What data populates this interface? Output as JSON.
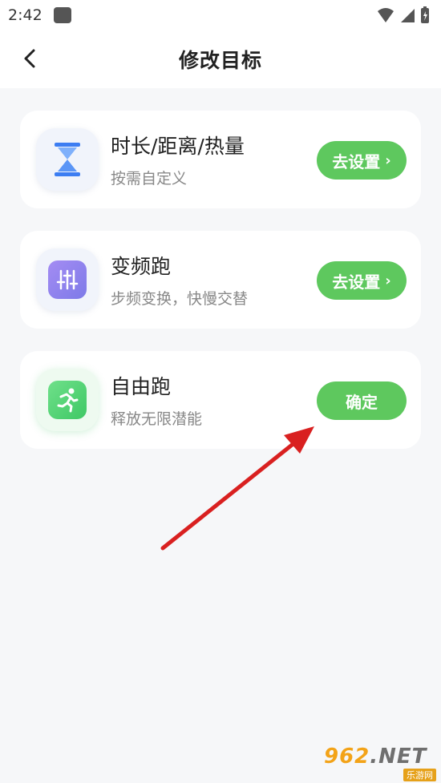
{
  "status_bar": {
    "time": "2:42"
  },
  "header": {
    "title": "修改目标"
  },
  "cards": [
    {
      "title": "时长/距离/热量",
      "subtitle": "按需自定义",
      "button": "去设置",
      "icon": "hourglass-icon",
      "icon_color": "#4f8cf5"
    },
    {
      "title": "变频跑",
      "subtitle": "步频变换，快慢交替",
      "button": "去设置",
      "icon": "sliders-icon",
      "icon_color": "#8f82ee"
    },
    {
      "title": "自由跑",
      "subtitle": "释放无限潜能",
      "button": "确定",
      "icon": "running-icon",
      "icon_color": "#4fcf6b"
    }
  ],
  "colors": {
    "accent_green": "#5ec85e",
    "annotation_arrow": "#d92020"
  },
  "watermark": {
    "top": "962",
    "net": ".NET",
    "bottom": "乐游网"
  }
}
